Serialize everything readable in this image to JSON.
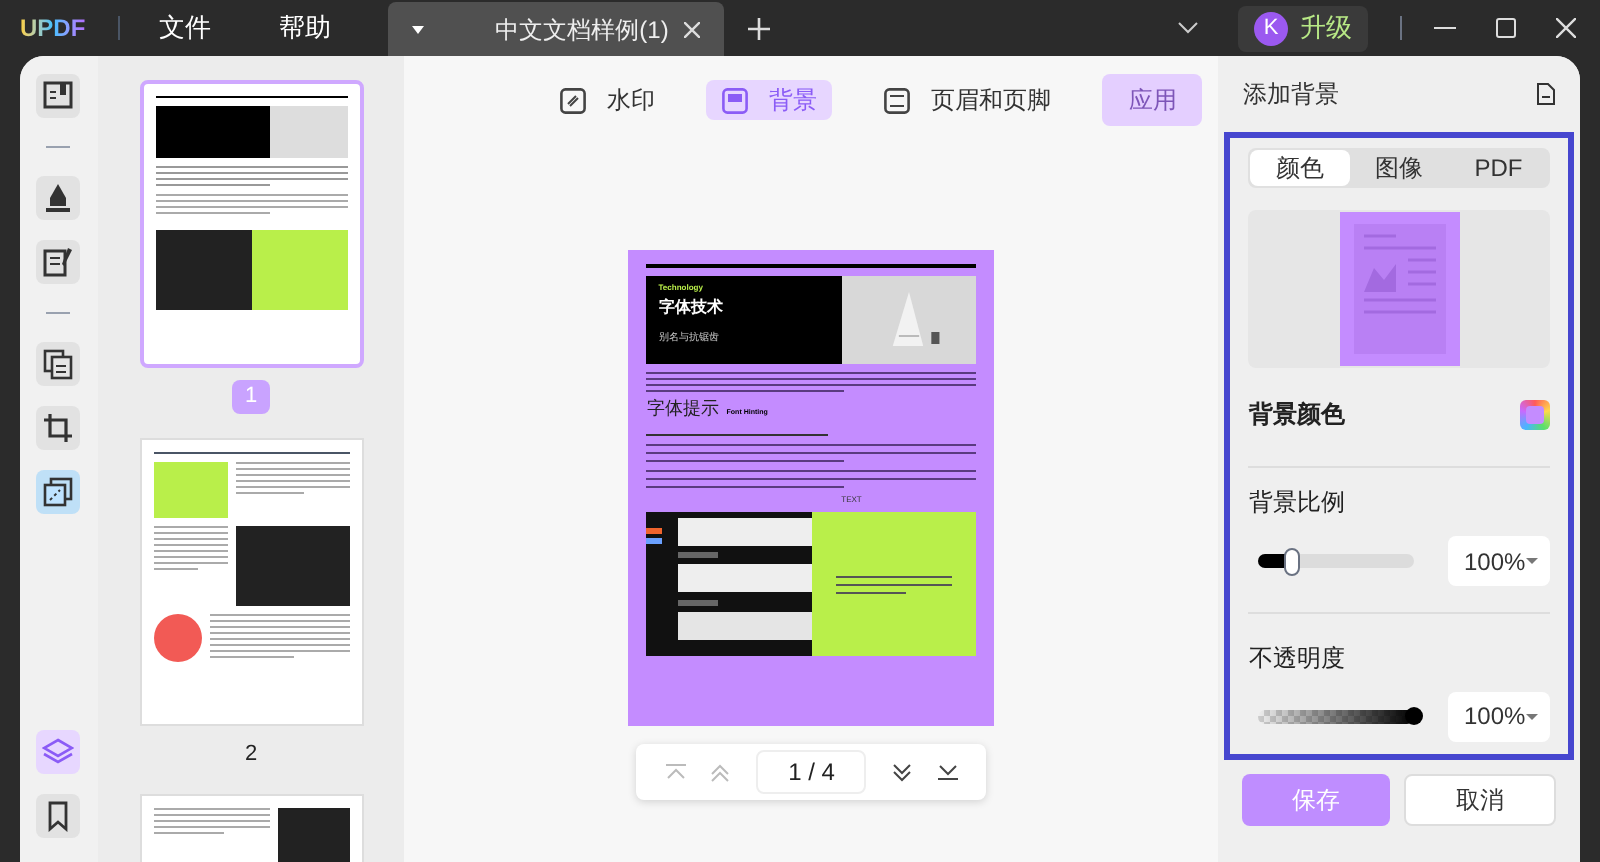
{
  "app": {
    "logo": "UPDF",
    "menus": [
      "文件",
      "帮助"
    ]
  },
  "tabs": [
    {
      "label": "中文文档样例(1)",
      "selected": true
    }
  ],
  "account": {
    "avatar": "K",
    "upgrade": "升级"
  },
  "tool_rail": [
    {
      "kind": "reader",
      "selected": false
    },
    {
      "kind": "separator"
    },
    {
      "kind": "comment",
      "selected": false
    },
    {
      "kind": "edit",
      "selected": false
    },
    {
      "kind": "separator"
    },
    {
      "kind": "organize",
      "selected": false
    },
    {
      "kind": "crop",
      "selected": false
    },
    {
      "kind": "tools",
      "selected": true
    }
  ],
  "rail_bottom": [
    {
      "kind": "layers",
      "selected": true
    },
    {
      "kind": "bookmark",
      "selected": false
    }
  ],
  "thumbnails": [
    {
      "label": "1",
      "selected": true
    },
    {
      "label": "2",
      "selected": false
    },
    {
      "selected": false
    }
  ],
  "toolbar": [
    {
      "kind": "watermark",
      "label": "水印",
      "selected": false
    },
    {
      "kind": "background",
      "label": "背景",
      "selected": true
    },
    {
      "kind": "header",
      "label": "页眉和页脚",
      "selected": false
    }
  ],
  "apply": {
    "label": "应用",
    "disabled": true
  },
  "page_preview": {
    "eyebrow": "Technology",
    "title": "字体技术",
    "subtitle": "别名与抗锯齿",
    "section": "字体提示",
    "section_en": "Font Hinting",
    "caption": "TEXT"
  },
  "pagination": {
    "current": "1 / 4"
  },
  "panel": {
    "title": "添加背景",
    "tabs": [
      {
        "label": "颜色",
        "selected": true
      },
      {
        "label": "图像",
        "selected": false
      },
      {
        "label": "PDF",
        "selected": false
      }
    ],
    "color_label": "背景颜色",
    "scale": {
      "label": "背景比例",
      "level": 0.21,
      "value": "100%"
    },
    "opacity": {
      "label": "不透明度",
      "level": 1,
      "value": "100%"
    },
    "buttons": [
      {
        "label": "保存",
        "kind": "primary"
      },
      {
        "label": "取消",
        "kind": "secondary"
      }
    ]
  }
}
